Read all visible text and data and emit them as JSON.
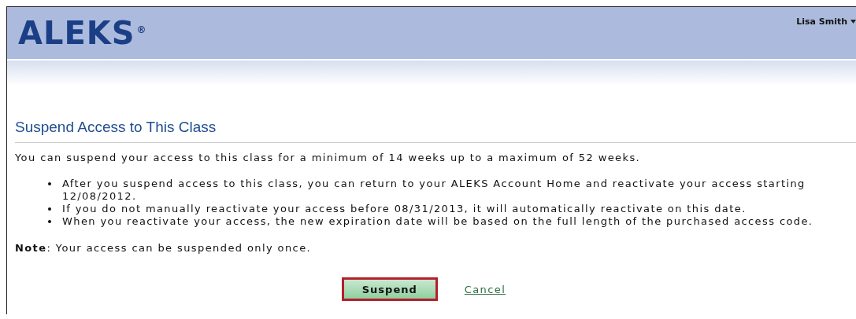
{
  "header": {
    "logo": "ALEKS",
    "logo_mark": "®",
    "user": "Lisa Smith"
  },
  "section": {
    "title": "Suspend Access to This Class"
  },
  "intro": "You can suspend your access to this class for a minimum of 14 weeks up to a maximum of 52 weeks.",
  "bullets": [
    "After you suspend access to this class, you can return to your ALEKS Account Home and reactivate your access starting 12/08/2012.",
    "If you do not manually reactivate your access before 08/31/2013, it will automatically reactivate on this date.",
    "When you reactivate your access, the new expiration date will be based on the full length of the purchased access code."
  ],
  "note": "**Note**: Your access can be suspended only once.",
  "buttons": [
    {
      "label": "Suspend",
      "kind": "button"
    },
    {
      "label": "Cancel",
      "kind": "link"
    }
  ]
}
